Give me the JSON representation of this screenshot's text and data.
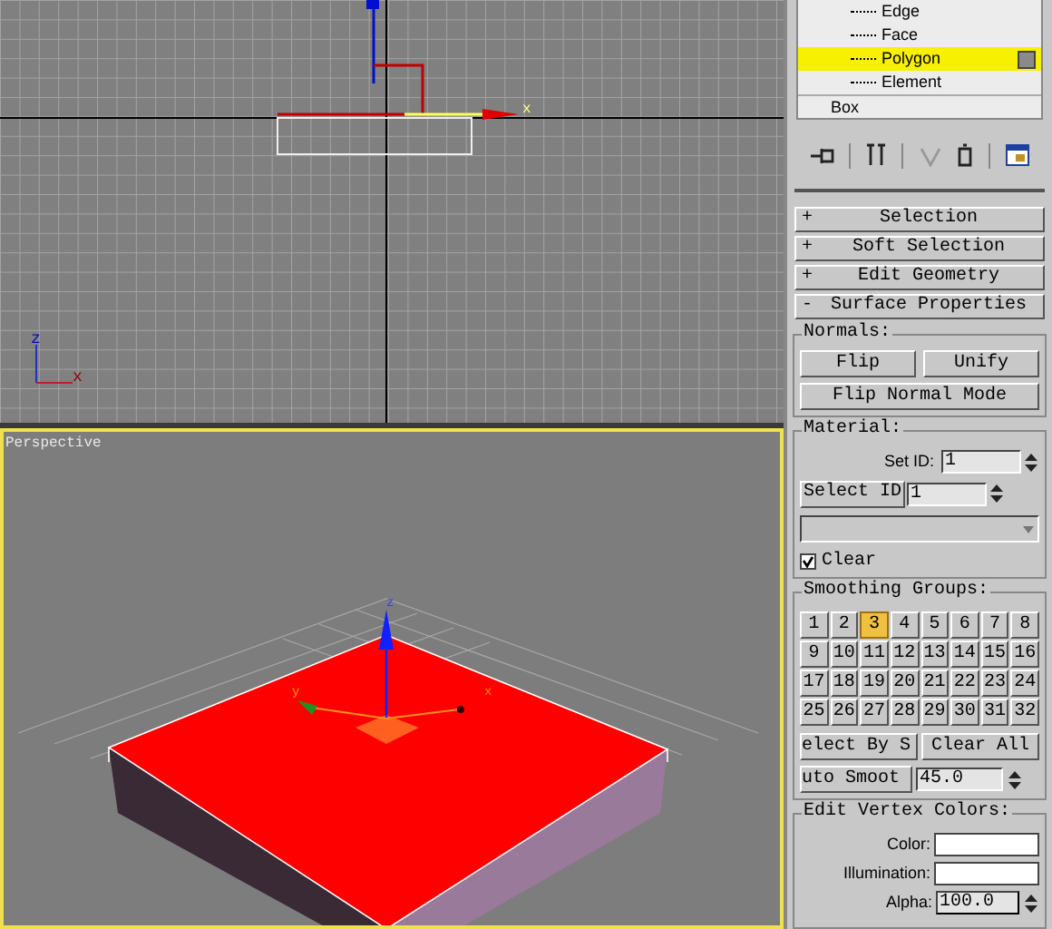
{
  "top_viewport": {
    "gizmo_label": "x",
    "tripod_labels": [
      "z",
      "x"
    ]
  },
  "perspective_viewport": {
    "label": "Perspective",
    "selected": true,
    "gizmo_labels": [
      "z",
      "y",
      "x"
    ]
  },
  "modifier_stack": {
    "items": [
      {
        "label": "Edge",
        "selected": false
      },
      {
        "label": "Face",
        "selected": false
      },
      {
        "label": "Polygon",
        "selected": true
      },
      {
        "label": "Element",
        "selected": false
      }
    ],
    "base": "Box"
  },
  "rollouts": [
    {
      "sign": "+",
      "title": "Selection"
    },
    {
      "sign": "+",
      "title": "Soft Selection"
    },
    {
      "sign": "+",
      "title": "Edit Geometry"
    },
    {
      "sign": "-",
      "title": "Surface Properties"
    }
  ],
  "normals": {
    "title": "Normals:",
    "buttons": [
      "Flip",
      "Unify"
    ],
    "mode_button": "Flip Normal Mode"
  },
  "material": {
    "title": "Material:",
    "set_id_label": "Set ID:",
    "set_id": "1",
    "select_id_button": "Select ID",
    "select_id": "1",
    "clear": {
      "label": "Clear",
      "checked": true
    }
  },
  "smoothing": {
    "title": "Smoothing Groups:",
    "groups": [
      {
        "label": "1",
        "selected": false
      },
      {
        "label": "2",
        "selected": false
      },
      {
        "label": "3",
        "selected": true
      },
      {
        "label": "4",
        "selected": false
      },
      {
        "label": "5",
        "selected": false
      },
      {
        "label": "6",
        "selected": false
      },
      {
        "label": "7",
        "selected": false
      },
      {
        "label": "8",
        "selected": false
      },
      {
        "label": "9",
        "selected": false
      },
      {
        "label": "10",
        "selected": false
      },
      {
        "label": "11",
        "selected": false
      },
      {
        "label": "12",
        "selected": false
      },
      {
        "label": "13",
        "selected": false
      },
      {
        "label": "14",
        "selected": false
      },
      {
        "label": "15",
        "selected": false
      },
      {
        "label": "16",
        "selected": false
      },
      {
        "label": "17",
        "selected": false
      },
      {
        "label": "18",
        "selected": false
      },
      {
        "label": "19",
        "selected": false
      },
      {
        "label": "20",
        "selected": false
      },
      {
        "label": "21",
        "selected": false
      },
      {
        "label": "22",
        "selected": false
      },
      {
        "label": "23",
        "selected": false
      },
      {
        "label": "24",
        "selected": false
      },
      {
        "label": "25",
        "selected": false
      },
      {
        "label": "26",
        "selected": false
      },
      {
        "label": "27",
        "selected": false
      },
      {
        "label": "28",
        "selected": false
      },
      {
        "label": "29",
        "selected": false
      },
      {
        "label": "30",
        "selected": false
      },
      {
        "label": "31",
        "selected": false
      },
      {
        "label": "32",
        "selected": false
      }
    ],
    "select_by_button": "elect By S",
    "clear_all_button": "Clear All",
    "auto_smooth_button": "uto Smoot",
    "threshold": "45.0"
  },
  "vertex_colors": {
    "title": "Edit Vertex Colors:",
    "fields": [
      {
        "label": "Color:",
        "kind": "swatch"
      },
      {
        "label": "Illumination:",
        "kind": "swatch"
      },
      {
        "label": "Alpha:",
        "kind": "spinner",
        "value": "100.0"
      }
    ]
  }
}
